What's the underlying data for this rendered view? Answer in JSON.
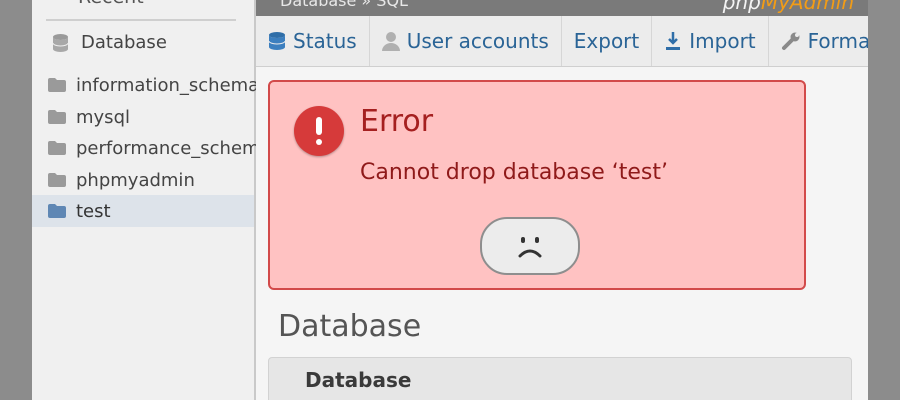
{
  "sidebar": {
    "recent_label": "Recent",
    "database_label": "Database",
    "databases": [
      {
        "name": "information_schema",
        "selected": false
      },
      {
        "name": "mysql",
        "selected": false
      },
      {
        "name": "performance_schema",
        "selected": false
      },
      {
        "name": "phpmyadmin",
        "selected": false
      },
      {
        "name": "test",
        "selected": true
      }
    ]
  },
  "topbar": {
    "breadcrumb": "Database » SQL",
    "logo_prefix": "php",
    "logo_suffix": "MyAdmin"
  },
  "tabs": [
    {
      "label": "Status",
      "icon": "database-icon"
    },
    {
      "label": "User accounts",
      "icon": "user-icon"
    },
    {
      "label": "Export",
      "icon": ""
    },
    {
      "label": "Import",
      "icon": "import-icon"
    },
    {
      "label": "Forma",
      "icon": "wrench-icon"
    }
  ],
  "error": {
    "title": "Error",
    "message": "Cannot drop database ‘test’"
  },
  "main": {
    "section_title": "Database",
    "panel_title": "Database"
  },
  "colors": {
    "error_bg": "#ffc2c2",
    "error_border": "#d24a4a",
    "error_text": "#8f1a1a",
    "link": "#2a6496",
    "accent": "#f29c16"
  }
}
